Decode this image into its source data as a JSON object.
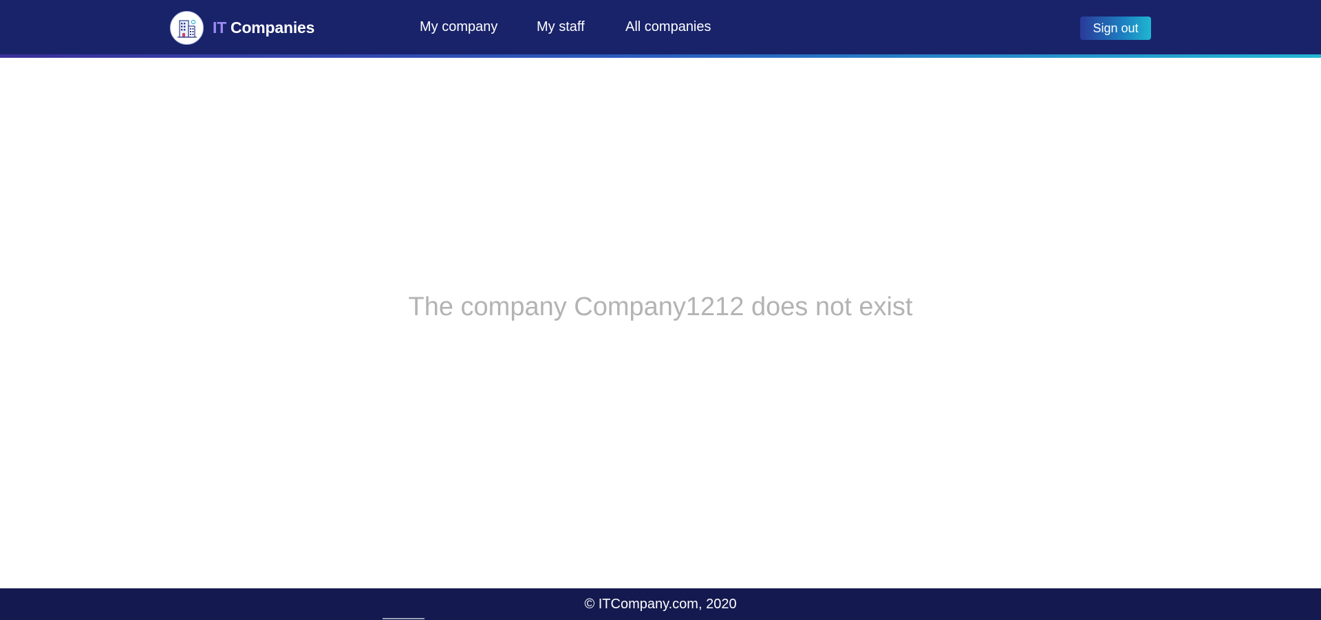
{
  "colors": {
    "header_bg": "#19236a",
    "footer_bg": "#141a4f",
    "brand_accent": "#9d8df5",
    "message_text": "#b3b3b3",
    "button_gradient_start": "#2a3a9a",
    "button_gradient_end": "#1fb6d1"
  },
  "header": {
    "logo_icon": "office-building-icon",
    "brand_prefix": "IT",
    "brand_name": "Companies",
    "nav": [
      {
        "label": "My company"
      },
      {
        "label": "My staff"
      },
      {
        "label": "All companies"
      }
    ],
    "signout_label": "Sign out"
  },
  "main": {
    "message": "The company Company1212 does not exist"
  },
  "footer": {
    "copyright": "© ITCompany.com, 2020"
  }
}
